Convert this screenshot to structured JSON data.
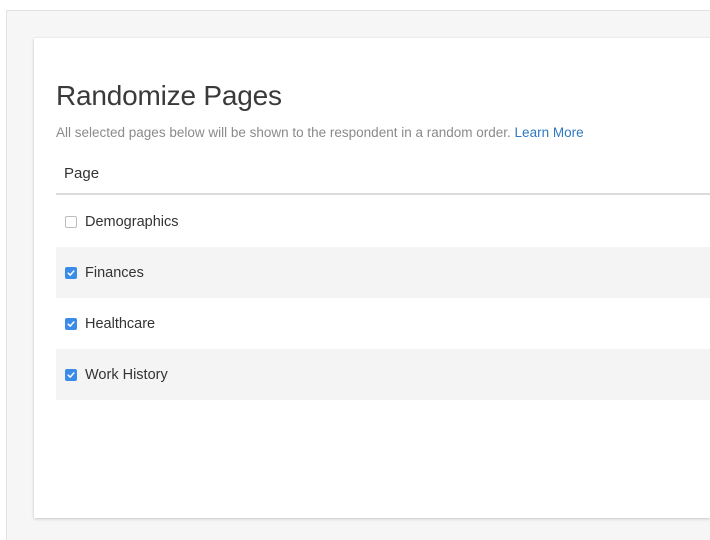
{
  "dialog": {
    "title": "Randomize Pages",
    "description": "All selected pages below will be shown to the respondent in a random order.",
    "learn_more": "Learn More"
  },
  "table": {
    "column_header": "Page",
    "rows": [
      {
        "label": "Demographics",
        "checked": false
      },
      {
        "label": "Finances",
        "checked": true
      },
      {
        "label": "Healthcare",
        "checked": true
      },
      {
        "label": "Work History",
        "checked": true
      }
    ]
  },
  "colors": {
    "accent": "#3b8be8",
    "link": "#2f7ac2"
  },
  "icons": {
    "checked": "checkmark-icon"
  }
}
